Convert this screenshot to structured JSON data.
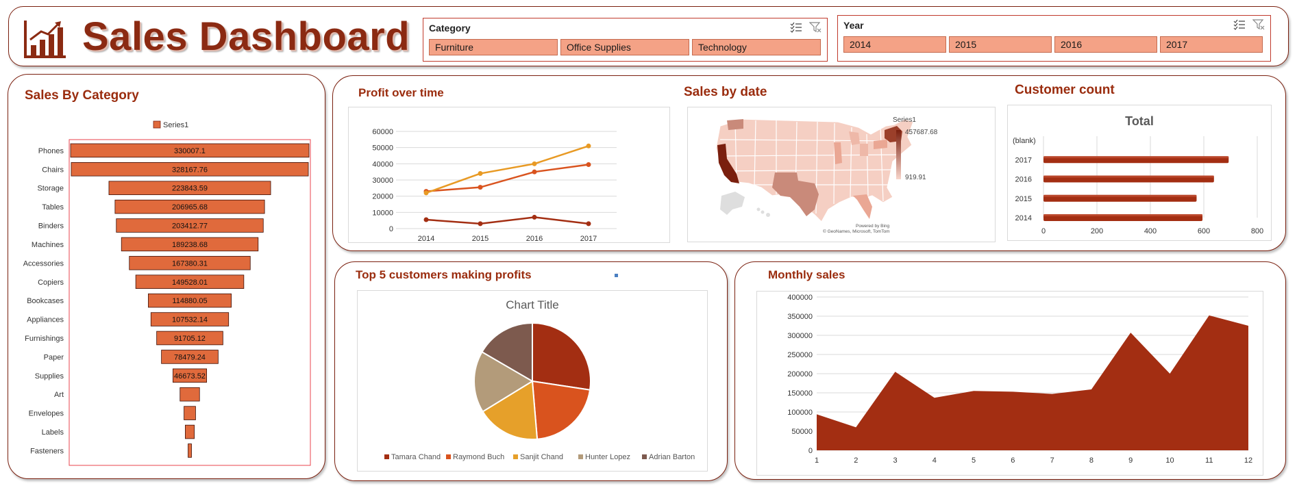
{
  "header": {
    "title": "Sales Dashboard",
    "logo_icon": "bar-chart-trend-icon",
    "colors": {
      "title": "#8b2a12",
      "accent": "#9a2c0e"
    }
  },
  "category_slicer": {
    "title": "Category",
    "items": [
      "Furniture",
      "Office Supplies",
      "Technology"
    ],
    "icons": [
      "multi-select-icon",
      "clear-filter-icon"
    ]
  },
  "year_slicer": {
    "title": "Year",
    "items": [
      "2014",
      "2015",
      "2016",
      "2017"
    ],
    "icons": [
      "multi-select-icon",
      "clear-filter-icon"
    ]
  },
  "sales_by_category": {
    "title": "Sales By Category",
    "legend": "Series1",
    "chart_data": {
      "type": "bar",
      "subtype": "funnel",
      "categories": [
        "Phones",
        "Chairs",
        "Storage",
        "Tables",
        "Binders",
        "Machines",
        "Accessories",
        "Copiers",
        "Bookcases",
        "Appliances",
        "Furnishings",
        "Paper",
        "Supplies",
        "Art",
        "Envelopes",
        "Labels",
        "Fasteners"
      ],
      "values": [
        330007.1,
        328167.76,
        223843.59,
        206965.68,
        203412.77,
        189238.68,
        167380.31,
        149528.01,
        114880.05,
        107532.14,
        91705.12,
        78479.24,
        46673.52,
        27000,
        16000,
        12500,
        3000
      ],
      "data_labels": [
        "330007.1",
        "328167.76",
        "223843.59",
        "206965.68",
        "203412.77",
        "189238.68",
        "167380.31",
        "149528.01",
        "114880.05",
        "107532.14",
        "91705.12",
        "78479.24",
        "46673.52",
        "",
        "",
        "",
        ""
      ],
      "legend_placement": "top",
      "color": "#e06a3c"
    }
  },
  "profit_over_time": {
    "title": "Profit over time",
    "chart_data": {
      "type": "line",
      "x": [
        "2014",
        "2015",
        "2016",
        "2017"
      ],
      "series": [
        {
          "values": [
            23000,
            25500,
            35000,
            39500
          ],
          "color": "#d9531e"
        },
        {
          "values": [
            22000,
            34000,
            40000,
            51000
          ],
          "color": "#e89a24"
        },
        {
          "values": [
            5500,
            3000,
            7000,
            3000
          ],
          "color": "#a32e12"
        }
      ],
      "ylim": [
        0,
        60000
      ],
      "yticks": [
        "0",
        "10000",
        "20000",
        "30000",
        "40000",
        "50000",
        "60000"
      ],
      "grid": true
    }
  },
  "sales_by_date": {
    "title": "Sales by date",
    "legend_title": "Series1",
    "legend_max": "457687.68",
    "legend_min": "919.91",
    "credit_line1": "Powered by Bing",
    "credit_line2": "© GeoNames, Microsoft, TomTom",
    "colors": {
      "high": "#7a1f0e",
      "low": "#f8d6cc"
    }
  },
  "customer_count": {
    "title": "Customer count",
    "chart_data": {
      "type": "bar",
      "orientation": "horizontal",
      "title": "Total",
      "categories": [
        "(blank)",
        "2017",
        "2016",
        "2015",
        "2014"
      ],
      "values": [
        0,
        693,
        638,
        573,
        595
      ],
      "xlim": [
        0,
        800
      ],
      "xticks": [
        "0",
        "200",
        "400",
        "600",
        "800"
      ],
      "grid": true,
      "color": "#a32e12"
    }
  },
  "top5": {
    "title": "Top 5 customers making profits",
    "chart_data": {
      "type": "pie",
      "title": "Chart Title",
      "labels": [
        "Tamara Chand",
        "Raymond Buch",
        "Sanjit Chand",
        "Hunter Lopez",
        "Adrian Barton"
      ],
      "values": [
        8981,
        6976,
        5757,
        5622,
        5444
      ],
      "colors": [
        "#a32e12",
        "#d9531e",
        "#e6a02a",
        "#b39b7a",
        "#7d5a4e"
      ],
      "legend_placement": "bottom"
    }
  },
  "monthly_sales": {
    "title": "Monthly sales",
    "chart_data": {
      "type": "area",
      "x": [
        "1",
        "2",
        "3",
        "4",
        "5",
        "6",
        "7",
        "8",
        "9",
        "10",
        "11",
        "12"
      ],
      "values": [
        94000,
        60000,
        205000,
        137000,
        155000,
        153000,
        147000,
        159000,
        307000,
        200000,
        352000,
        325000
      ],
      "ylim": [
        0,
        400000
      ],
      "yticks": [
        "0",
        "50000",
        "100000",
        "150000",
        "200000",
        "250000",
        "300000",
        "350000",
        "400000"
      ],
      "grid": true,
      "color": "#a32e12"
    }
  }
}
